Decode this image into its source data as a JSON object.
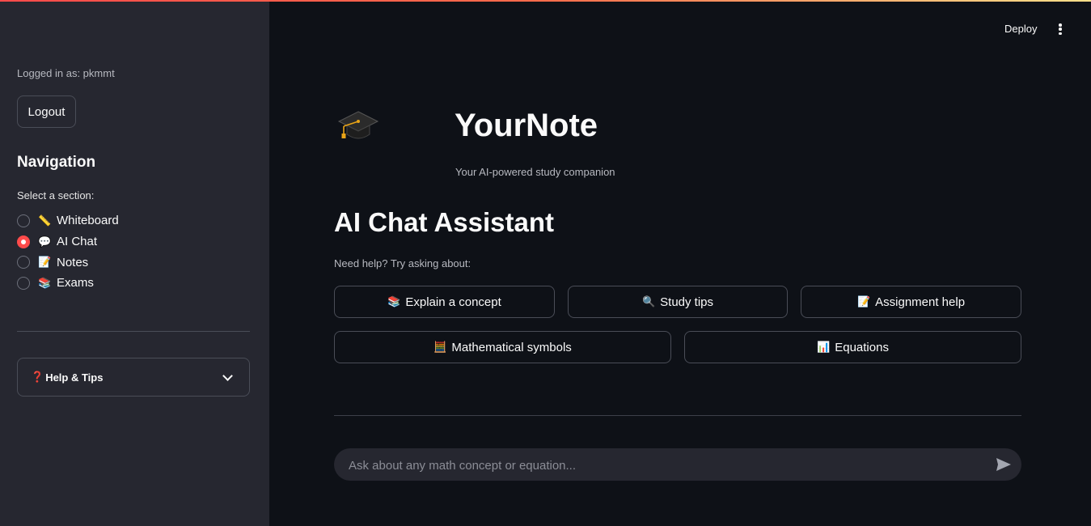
{
  "header": {
    "deploy_label": "Deploy",
    "menu_icon": "kebab-menu-icon"
  },
  "sidebar": {
    "logged_in_text": "Logged in as: pkmmt",
    "logout_label": "Logout",
    "nav_title": "Navigation",
    "select_label": "Select a section:",
    "items": [
      {
        "emoji": "📏",
        "label": "Whiteboard",
        "checked": false
      },
      {
        "emoji": "💬",
        "label": "AI Chat",
        "checked": true
      },
      {
        "emoji": "📝",
        "label": "Notes",
        "checked": false
      },
      {
        "emoji": "📚",
        "label": "Exams",
        "checked": false
      }
    ],
    "help_icon": "❓",
    "help_label": "Help & Tips"
  },
  "main": {
    "app_icon": "graduation-cap-icon",
    "app_title": "YourNote",
    "app_subtitle": "Your AI-powered study companion",
    "chat_title": "AI Chat Assistant",
    "help_prompt": "Need help? Try asking about:",
    "quick_buttons": [
      {
        "emoji": "📚",
        "label": "Explain a concept"
      },
      {
        "emoji": "🔍",
        "label": "Study tips"
      },
      {
        "emoji": "📝",
        "label": "Assignment help"
      },
      {
        "emoji": "🧮",
        "label": "Mathematical symbols"
      },
      {
        "emoji": "📊",
        "label": "Equations"
      }
    ],
    "chat_placeholder": "Ask about any math concept or equation..."
  },
  "colors": {
    "accent": "#ff4b4b",
    "background": "#0e1117",
    "sidebar": "#262730"
  }
}
